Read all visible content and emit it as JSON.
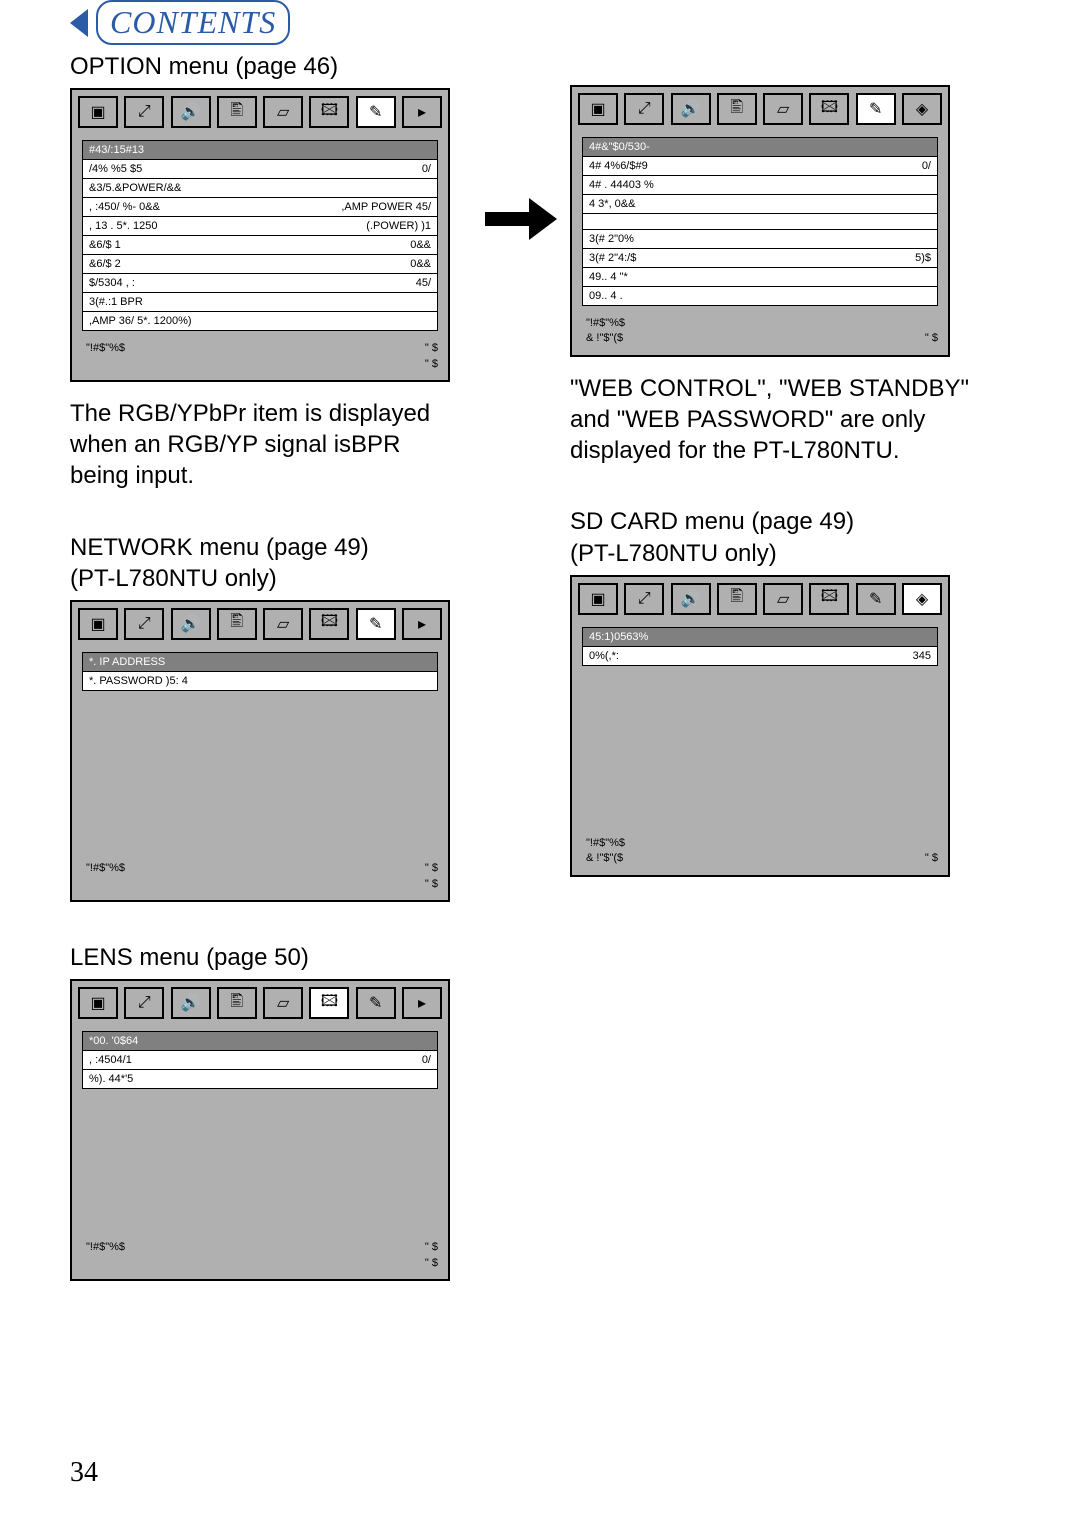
{
  "contents_label": "CONTENTS",
  "page_number": "34",
  "option_menu": {
    "heading": "OPTION menu  (page 46)",
    "rows": [
      {
        "label": "#43/:15#13",
        "value": ""
      },
      {
        "label": "/4% %5 $5",
        "value": "0/"
      },
      {
        "label": "&3/5.&POWER/&&",
        "value": ""
      },
      {
        "label": ", :450/ %- 0&&",
        "value": ",AMP POWER  45/"
      },
      {
        "label": ", 13 . 5*. 1250",
        "value": "(.POWER)   )1"
      },
      {
        "label": "&6/$ 1",
        "value": "0&&"
      },
      {
        "label": "&6/$ 2",
        "value": "0&&"
      },
      {
        "label": "$/5304 , : ",
        "value": "45/"
      },
      {
        "label": "3(#.:1 BPR",
        "value": ""
      },
      {
        "label": ",AMP 36/ 5*. 1200%)",
        "value": ""
      }
    ],
    "footer": [
      {
        "left": "\"!#$\"%$",
        "right": "\"   $"
      },
      {
        "left": "",
        "right": "\"   $"
      }
    ],
    "caption_parts": [
      "The RGB/YPbPr item is displayed",
      "when an RGB/YP signal is",
      "being input."
    ],
    "small_caps_part": "BPR"
  },
  "option_cont": {
    "rows": [
      {
        "label": "4#&\"$0/530-",
        "value": ""
      },
      {
        "label": "4# 4%6/$#9",
        "value": "0/"
      },
      {
        "label": "4# . 44403 %",
        "value": ""
      },
      {
        "label": "4 3*, 0&&",
        "value": ""
      },
      {
        "label": "",
        "value": ""
      },
      {
        "label": "3(# 2\"0%",
        "value": ""
      },
      {
        "label": "3(# 2\"4:/$",
        "value": "5)$"
      },
      {
        "label": "49.. 4 \"*",
        "value": ""
      },
      {
        "label": "09.. 4 .",
        "value": ""
      }
    ],
    "footer": [
      {
        "left": "\"!#$\"%$",
        "right": ""
      },
      {
        "left": "& !\"$\"($",
        "right": "\"   $"
      }
    ],
    "caption_parts": [
      "\"WEB CONTROL\", \"WEB STANDBY\"",
      "and \"WEB PASSWORD\" are only",
      "displayed for the PT-L780NTU."
    ]
  },
  "network_menu": {
    "heading_line1": "NETWORK menu  (page 49)",
    "heading_line2": "(PT-L780NTU only)",
    "rows": [
      {
        "label": "*. IP ADDRESS",
        "value": ""
      },
      {
        "label": "*. PASSWORD )5: 4",
        "value": ""
      }
    ],
    "footer": [
      {
        "left": "\"!#$\"%$",
        "right": "\"   $"
      },
      {
        "left": "",
        "right": "\"   $"
      }
    ]
  },
  "sd_menu": {
    "heading_line1": "SD CARD menu  (page 49)",
    "heading_line2": "(PT-L780NTU only)",
    "rows": [
      {
        "label": "45:1)0563%",
        "value": ""
      },
      {
        "label": "0%(,*:",
        "value": "345"
      }
    ],
    "footer": [
      {
        "left": "\"!#$\"%$",
        "right": ""
      },
      {
        "left": "& !\"$\"($",
        "right": "\"   $"
      }
    ]
  },
  "lens_menu": {
    "heading": "LENS menu  (page 50)",
    "rows": [
      {
        "label": "*00. '0$64",
        "value": ""
      },
      {
        "label": ", :4504/1",
        "value": "0/"
      },
      {
        "label": "%). 44*'5",
        "value": ""
      }
    ],
    "footer": [
      {
        "left": "\"!#$\"%$",
        "right": "\"   $"
      },
      {
        "left": "",
        "right": "\"   $"
      }
    ]
  },
  "icons": [
    "picture",
    "zoom",
    "audio",
    "language",
    "keystone",
    "image",
    "option",
    "card"
  ]
}
